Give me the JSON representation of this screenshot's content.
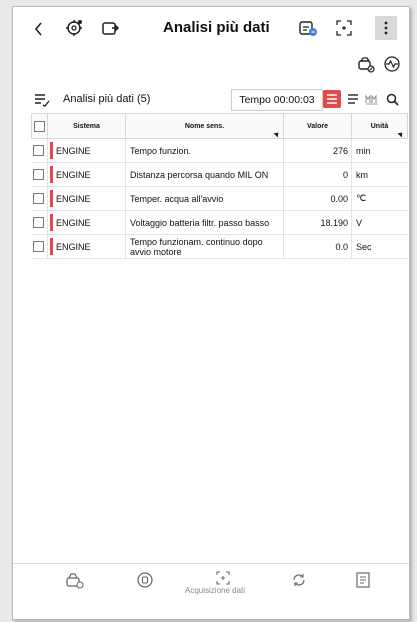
{
  "header": {
    "title": "Analisi più dati"
  },
  "subheader": {
    "title": "Analisi più dati (5)",
    "timer": "Tempo 00:00:03"
  },
  "table": {
    "columns": [
      "Sistema",
      "Nome sens.",
      "Valore",
      "Unità"
    ],
    "rows": [
      {
        "system": "ENGINE",
        "name": "Tempo funzion.",
        "value": "276",
        "unit": "min"
      },
      {
        "system": "ENGINE",
        "name": "Distanza percorsa quando MIL ON",
        "value": "0",
        "unit": "km"
      },
      {
        "system": "ENGINE",
        "name": "Temper. acqua all'avvio",
        "value": "0.00",
        "unit": "℃"
      },
      {
        "system": "ENGINE",
        "name": "Voltaggio batteria filtr. passo basso",
        "value": "18.190",
        "unit": "V"
      },
      {
        "system": "ENGINE",
        "name": "Tempo funzionam. continuo dopo avvio motore",
        "value": "0.0",
        "unit": "Sec"
      }
    ]
  },
  "bottom": {
    "capture_label": "Acquisizione dati"
  },
  "colors": {
    "accent": "#e24b4b"
  }
}
